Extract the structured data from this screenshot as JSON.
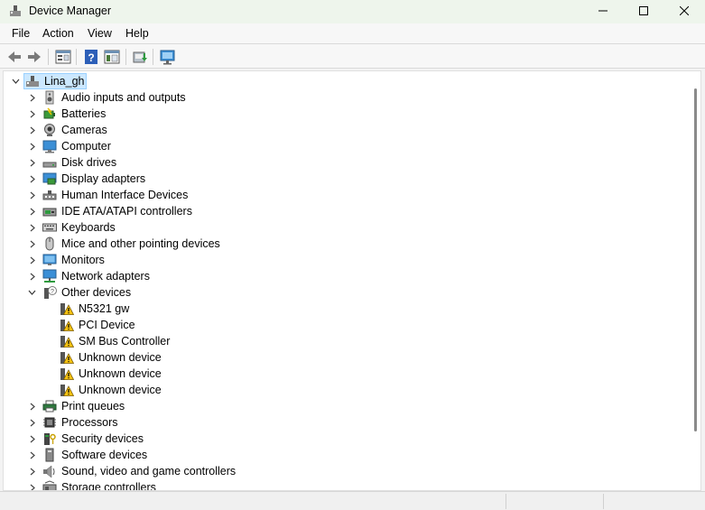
{
  "window": {
    "title": "Device Manager"
  },
  "menu": {
    "items": [
      "File",
      "Action",
      "View",
      "Help"
    ]
  },
  "toolbar": {
    "buttons": [
      "back-icon",
      "forward-icon",
      "properties-icon",
      "help-icon",
      "show-hide-console-tree-icon",
      "update-driver-icon",
      "scan-for-changes-icon"
    ]
  },
  "tree": {
    "root": "Lina_gh",
    "categories": [
      {
        "label": "Audio inputs and outputs",
        "icon": "speaker-icon"
      },
      {
        "label": "Batteries",
        "icon": "battery-icon"
      },
      {
        "label": "Cameras",
        "icon": "camera-icon"
      },
      {
        "label": "Computer",
        "icon": "computer-icon"
      },
      {
        "label": "Disk drives",
        "icon": "disk-drive-icon"
      },
      {
        "label": "Display adapters",
        "icon": "display-adapter-icon"
      },
      {
        "label": "Human Interface Devices",
        "icon": "hid-icon"
      },
      {
        "label": "IDE ATA/ATAPI controllers",
        "icon": "ide-controller-icon"
      },
      {
        "label": "Keyboards",
        "icon": "keyboard-icon"
      },
      {
        "label": "Mice and other pointing devices",
        "icon": "mouse-icon"
      },
      {
        "label": "Monitors",
        "icon": "monitor-icon"
      },
      {
        "label": "Network adapters",
        "icon": "network-adapter-icon"
      },
      {
        "label": "Other devices",
        "icon": "other-devices-icon",
        "expanded": true,
        "children": [
          "N5321 gw",
          "PCI Device",
          "SM Bus Controller",
          "Unknown device",
          "Unknown device",
          "Unknown device"
        ]
      },
      {
        "label": "Print queues",
        "icon": "printer-icon"
      },
      {
        "label": "Processors",
        "icon": "processor-icon"
      },
      {
        "label": "Security devices",
        "icon": "security-device-icon"
      },
      {
        "label": "Software devices",
        "icon": "software-device-icon"
      },
      {
        "label": "Sound, video and game controllers",
        "icon": "sound-controller-icon"
      },
      {
        "label": "Storage controllers",
        "icon": "storage-controller-icon"
      }
    ]
  },
  "colors": {
    "selection": "#cce8ff",
    "warning": "#f5c211",
    "monitor_blue": "#3b8fd6"
  }
}
